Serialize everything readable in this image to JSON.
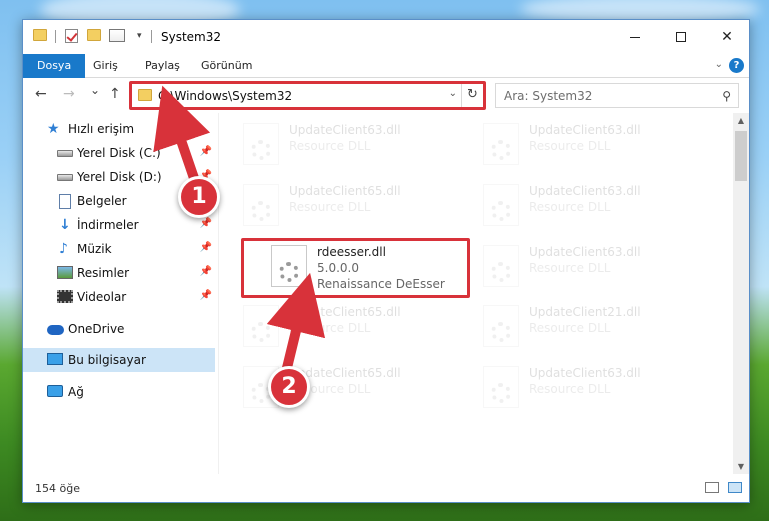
{
  "window": {
    "title": "System32",
    "controls": {
      "minimize": "minimize",
      "maximize": "maximize",
      "close": "✕"
    }
  },
  "ribbon": {
    "tabs": [
      {
        "label": "Dosya",
        "active": true
      },
      {
        "label": "Giriş"
      },
      {
        "label": "Paylaş"
      },
      {
        "label": "Görünüm"
      }
    ],
    "help": "?"
  },
  "nav": {
    "back": "←",
    "forward": "→",
    "recent": "⌄",
    "up": "↑",
    "address": "C:\\Windows\\System32",
    "refresh": "↻",
    "search_placeholder": "Ara: System32"
  },
  "sidebar": {
    "quick_access": "Hızlı erişim",
    "items": [
      {
        "label": "Yerel Disk (C:)",
        "pinned": true,
        "icon": "disk-icon"
      },
      {
        "label": "Yerel Disk (D:)",
        "pinned": true,
        "icon": "disk-icon"
      },
      {
        "label": "Belgeler",
        "pinned": true,
        "icon": "documents-icon"
      },
      {
        "label": "İndirmeler",
        "pinned": true,
        "icon": "downloads-icon"
      },
      {
        "label": "Müzik",
        "pinned": true,
        "icon": "music-icon"
      },
      {
        "label": "Resimler",
        "pinned": true,
        "icon": "pictures-icon"
      },
      {
        "label": "Videolar",
        "pinned": true,
        "icon": "videos-icon"
      }
    ],
    "onedrive": "OneDrive",
    "this_pc": "Bu bilgisayar",
    "network": "Ağ"
  },
  "files": [
    {
      "name": "UpdateClient63.dll",
      "type": "Resource DLL",
      "faded": true
    },
    {
      "name": "UpdateClient63.dll",
      "type": "Resource DLL",
      "faded": true
    },
    {
      "name": "UpdateClient65.dll",
      "type": "Resource DLL",
      "faded": true
    },
    {
      "name": "UpdateClient63.dll",
      "type": "Resource DLL",
      "faded": true
    },
    {
      "name": "rdeesser.dll",
      "version": "5.0.0.0",
      "type": "Renaissance DeEsser",
      "faded": false
    },
    {
      "name": "UpdateClient63.dll",
      "type": "Resource DLL",
      "faded": true
    },
    {
      "name": "UpdateClient65.dll",
      "type": "Resource DLL",
      "faded": true
    },
    {
      "name": "UpdateClient21.dll",
      "type": "Resource DLL",
      "faded": true
    },
    {
      "name": "UpdateClient65.dll",
      "type": "Resource DLL",
      "faded": true
    },
    {
      "name": "UpdateClient63.dll",
      "type": "Resource DLL",
      "faded": true
    }
  ],
  "status": {
    "count": "154 öğe"
  },
  "annotations": {
    "marker1": "1",
    "marker2": "2"
  },
  "colors": {
    "accent": "#1979ca",
    "highlight": "#d8323a",
    "selected": "#cce4f7"
  }
}
